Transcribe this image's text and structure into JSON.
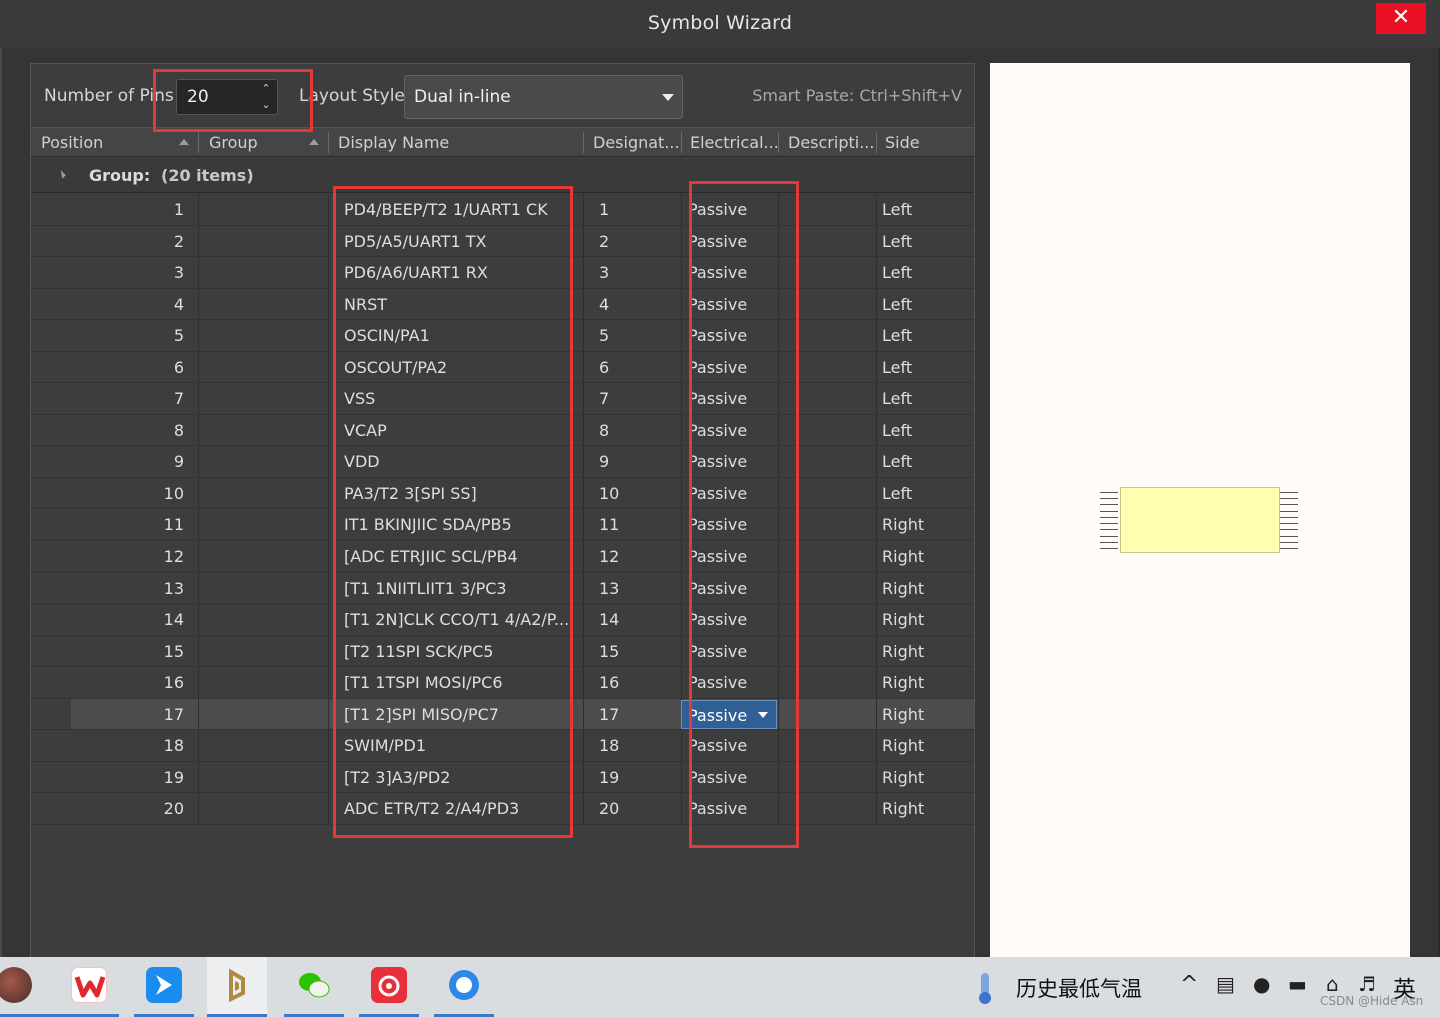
{
  "window": {
    "title": "Symbol Wizard",
    "close_glyph": "✕"
  },
  "toolbar": {
    "pins_label": "Number of Pins",
    "pins_value": "20",
    "layout_label": "Layout Style",
    "layout_value": "Dual in-line",
    "smart_paste": "Smart Paste: Ctrl+Shift+V"
  },
  "columns": {
    "position": "Position",
    "group": "Group",
    "display_name": "Display Name",
    "designator": "Designat...",
    "electrical": "Electrical...",
    "description": "Descripti...",
    "side": "Side"
  },
  "group_row": {
    "label": "Group:",
    "count": "(20 items)"
  },
  "pins": [
    {
      "pos": "1",
      "name": "PD4/BEEP/T2 1/UART1 CK",
      "des": "1",
      "elec": "Passive",
      "side": "Left"
    },
    {
      "pos": "2",
      "name": "PD5/A5/UART1 TX",
      "des": "2",
      "elec": "Passive",
      "side": "Left"
    },
    {
      "pos": "3",
      "name": "PD6/A6/UART1 RX",
      "des": "3",
      "elec": "Passive",
      "side": "Left"
    },
    {
      "pos": "4",
      "name": "NRST",
      "des": "4",
      "elec": "Passive",
      "side": "Left"
    },
    {
      "pos": "5",
      "name": "OSCIN/PA1",
      "des": "5",
      "elec": "Passive",
      "side": "Left"
    },
    {
      "pos": "6",
      "name": "OSCOUT/PA2",
      "des": "6",
      "elec": "Passive",
      "side": "Left"
    },
    {
      "pos": "7",
      "name": "VSS",
      "des": "7",
      "elec": "Passive",
      "side": "Left"
    },
    {
      "pos": "8",
      "name": "VCAP",
      "des": "8",
      "elec": "Passive",
      "side": "Left"
    },
    {
      "pos": "9",
      "name": "VDD",
      "des": "9",
      "elec": "Passive",
      "side": "Left"
    },
    {
      "pos": "10",
      "name": "PA3/T2 3[SPI SS]",
      "des": "10",
      "elec": "Passive",
      "side": "Left"
    },
    {
      "pos": "11",
      "name": "IT1 BKINJIIC SDA/PB5",
      "des": "11",
      "elec": "Passive",
      "side": "Right"
    },
    {
      "pos": "12",
      "name": "[ADC ETRJIIC SCL/PB4",
      "des": "12",
      "elec": "Passive",
      "side": "Right"
    },
    {
      "pos": "13",
      "name": "[T1 1NIITLIIT1 3/PC3",
      "des": "13",
      "elec": "Passive",
      "side": "Right"
    },
    {
      "pos": "14",
      "name": "[T1 2N]CLK CCO/T1 4/A2/P...",
      "des": "14",
      "elec": "Passive",
      "side": "Right"
    },
    {
      "pos": "15",
      "name": "[T2 11SPI SCK/PC5",
      "des": "15",
      "elec": "Passive",
      "side": "Right"
    },
    {
      "pos": "16",
      "name": "[T1 1TSPI MOSI/PC6",
      "des": "16",
      "elec": "Passive",
      "side": "Right"
    },
    {
      "pos": "17",
      "name": "[T1 2]SPI MISO/PC7",
      "des": "17",
      "elec": "Passive",
      "side": "Right"
    },
    {
      "pos": "18",
      "name": "SWIM/PD1",
      "des": "18",
      "elec": "Passive",
      "side": "Right"
    },
    {
      "pos": "19",
      "name": "[T2 3]A3/PD2",
      "des": "19",
      "elec": "Passive",
      "side": "Right"
    },
    {
      "pos": "20",
      "name": "ADC ETR/T2 2/A4/PD3",
      "des": "20",
      "elec": "Passive",
      "side": "Right"
    }
  ],
  "selected_row": "17",
  "colors": {
    "annotation_red": "#e23a3a",
    "selection_blue": "#2f5f95",
    "symbol_fill": "#ffffb0",
    "preview_bg": "#fffcf7"
  },
  "taskbar": {
    "apps": [
      {
        "name": "avatar-app-icon"
      },
      {
        "name": "wps-icon"
      },
      {
        "name": "feishu-icon"
      },
      {
        "name": "altium-designer-icon"
      },
      {
        "name": "wechat-icon"
      },
      {
        "name": "netease-music-icon"
      },
      {
        "name": "browser-icon"
      }
    ],
    "weather_text": "历史最低气温",
    "tray_chevron": "^",
    "ime_text": "英",
    "watermark": "CSDN @Hide Asn"
  }
}
